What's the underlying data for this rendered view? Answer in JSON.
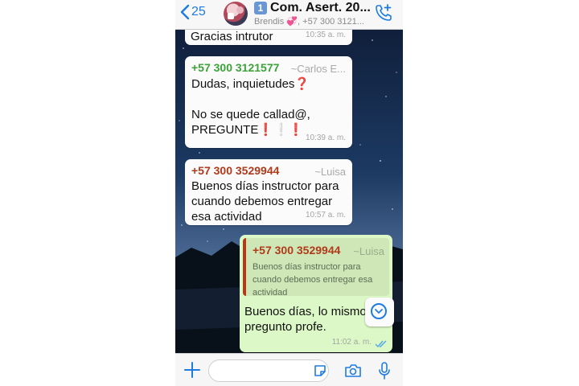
{
  "header": {
    "back_count": "25",
    "group_badge": "1",
    "group_title": "Com. Asert. 20...",
    "subtitle": "Brendis 💞, +57 300 3121..."
  },
  "messages": [
    {
      "text": "Gracias intrutor",
      "time": "10:35 a. m."
    },
    {
      "sender": "+57 300 3121577",
      "alias": "~Carlos E...",
      "line1": "Dudas, inquietudes❓",
      "line2": "No se quede callad@,",
      "line3": "PREGUNTE❗❕❗",
      "time": "10:39 a. m."
    },
    {
      "sender": "+57 300 3529944",
      "alias": "~Luisa",
      "text": "Buenos días instructor para\ncuando debemos entregar\nesa actividad",
      "time": "10:57 a. m."
    },
    {
      "quote_sender": "+57 300 3529944",
      "quote_alias": "~Luisa",
      "quote_text": "Buenos días instructor para cuando debemos entregar esa actividad",
      "text": "Buenos días, lo mismo\npregunto profe.",
      "time": "11:02 a. m."
    }
  ],
  "colors": {
    "accent": "#1e7ce0",
    "sender_green": "#3aa339",
    "sender_red": "#b03a1a",
    "outgoing_bubble": "#dcf8c6",
    "incoming_bubble": "#fbfbfb",
    "read_ticks": "#4fa6e8"
  },
  "icons": {
    "back": "chevron-left-icon",
    "call": "add-call-icon",
    "attach": "plus-icon",
    "sticker": "sticker-icon",
    "camera": "camera-icon",
    "mic": "microphone-icon",
    "scroll": "chevron-down-circle-icon",
    "ticks": "double-check-icon"
  }
}
